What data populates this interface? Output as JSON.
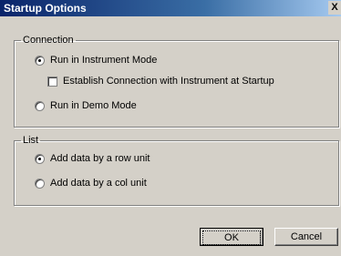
{
  "window": {
    "title": "Startup Options",
    "close_label": "X"
  },
  "connection": {
    "legend": "Connection",
    "instrument_mode": {
      "label": "Run in Instrument Mode",
      "selected": true
    },
    "establish_connection": {
      "label": "Establish Connection with Instrument at Startup",
      "checked": false
    },
    "demo_mode": {
      "label": "Run in Demo Mode",
      "selected": false
    }
  },
  "list": {
    "legend": "List",
    "row_unit": {
      "label": "Add data by a row unit",
      "selected": true
    },
    "col_unit": {
      "label": "Add data by a col unit",
      "selected": false
    }
  },
  "buttons": {
    "ok": "OK",
    "cancel": "Cancel"
  }
}
